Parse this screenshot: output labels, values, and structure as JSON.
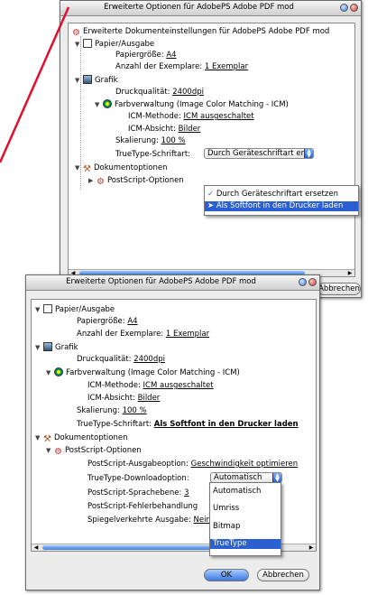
{
  "window1": {
    "title": "Erweiterte Optionen für AdobePS Adobe PDF mod",
    "root_label": "Erweiterte Dokumenteinstellungen für AdobePS Adobe PDF mod",
    "papier": "Papier/Ausgabe",
    "papiergroesse_label": "Papiergröße:",
    "papiergroesse_value": "A4",
    "exemplare_label": "Anzahl der Exemplare:",
    "exemplare_value": "1 Exemplar",
    "grafik": "Grafik",
    "druckqualitaet_label": "Druckqualität:",
    "druckqualitaet_value": "2400dpi",
    "farb": "Farbverwaltung (Image Color Matching - ICM)",
    "icm_methode_label": "ICM-Methode:",
    "icm_methode_value": "ICM ausgeschaltet",
    "icm_absicht_label": "ICM-Absicht:",
    "icm_absicht_value": "Bilder",
    "skalierung_label": "Skalierung:",
    "skalierung_value": "100 %",
    "truetype_label": "TrueType-Schriftart:",
    "truetype_popup": "Durch Geräteschriftart ersetzen",
    "dokumentoptionen": "Dokumentoptionen",
    "postscript": "PostScript-Optionen",
    "menu": [
      "Durch Geräteschriftart ersetzen",
      "Als Softfont in den Drucker laden"
    ],
    "partial_button": "Abbrechen"
  },
  "window2": {
    "title": "Erweiterte Optionen für AdobePS Adobe PDF mod",
    "papier": "Papier/Ausgabe",
    "papiergroesse_label": "Papiergröße:",
    "papiergroesse_value": "A4",
    "exemplare_label": "Anzahl der Exemplare:",
    "exemplare_value": "1 Exemplar",
    "grafik": "Grafik",
    "druckqualitaet_label": "Druckqualität:",
    "druckqualitaet_value": "2400dpi",
    "farb": "Farbverwaltung (Image Color Matching - ICM)",
    "icm_methode_label": "ICM-Methode:",
    "icm_methode_value": "ICM ausgeschaltet",
    "icm_absicht_label": "ICM-Absicht:",
    "icm_absicht_value": "Bilder",
    "skalierung_label": "Skalierung:",
    "skalierung_value": "100 %",
    "truetype_label": "TrueType-Schriftart:",
    "truetype_value": "Als Softfont in den Drucker laden",
    "dokumentoptionen": "Dokumentoptionen",
    "postscript": "PostScript-Optionen",
    "ps_ausgabe_label": "PostScript-Ausgabeoption:",
    "ps_ausgabe_value": "Geschwindigkeit optimieren",
    "tt_download_label": "TrueType-Downloadoption:",
    "tt_download_popup": "Automatisch",
    "ps_sprachebene_label": "PostScript-Sprachebene:",
    "ps_sprachebene_value": "3",
    "ps_fehler_label": "PostScript-Fehlerbehandlung",
    "spiegel_label": "Spiegelverkehrte Ausgabe:",
    "spiegel_value": "Nein",
    "menu": [
      "Automatisch",
      "Umriss",
      "Bitmap",
      "TrueType"
    ],
    "ok": "OK",
    "cancel": "Abbrechen"
  },
  "colors": {
    "accent": "#2c5fcf",
    "annotation_line": "#e0102a"
  }
}
